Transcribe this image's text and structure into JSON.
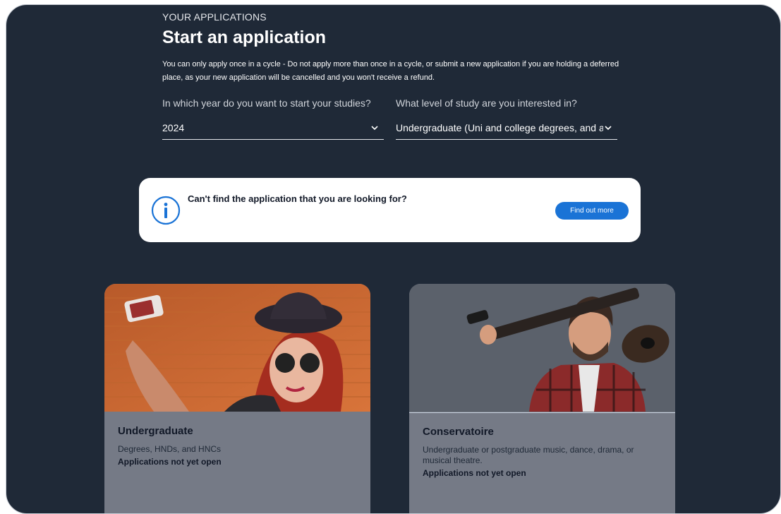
{
  "header": {
    "eyebrow": "YOUR APPLICATIONS",
    "title": "Start an application",
    "notice": "You can only apply once in a cycle - Do not apply more than once in a cycle, or submit a new application if you are holding a deferred place, as your new application will be cancelled and you won't receive a refund."
  },
  "form": {
    "year": {
      "label": "In which year do you want to start your studies?",
      "value": "2024"
    },
    "level": {
      "label": "What level of study are you interested in?",
      "value": "Undergraduate (Uni and college degrees, and ap…"
    }
  },
  "info_card": {
    "icon": "info-icon",
    "text": "Can't find the application that you are looking for?",
    "button": "Find out more"
  },
  "cards": [
    {
      "title": "Undergraduate",
      "description": "Degrees, HNDs, and HNCs",
      "status": "Applications not yet open"
    },
    {
      "title": "Conservatoire",
      "description": "Undergraduate or postgraduate music, dance, drama, or musical theatre.",
      "status": "Applications not yet open"
    }
  ],
  "colors": {
    "background": "#1f2937",
    "accent": "#1a73d6",
    "card_body": "#757a86"
  }
}
